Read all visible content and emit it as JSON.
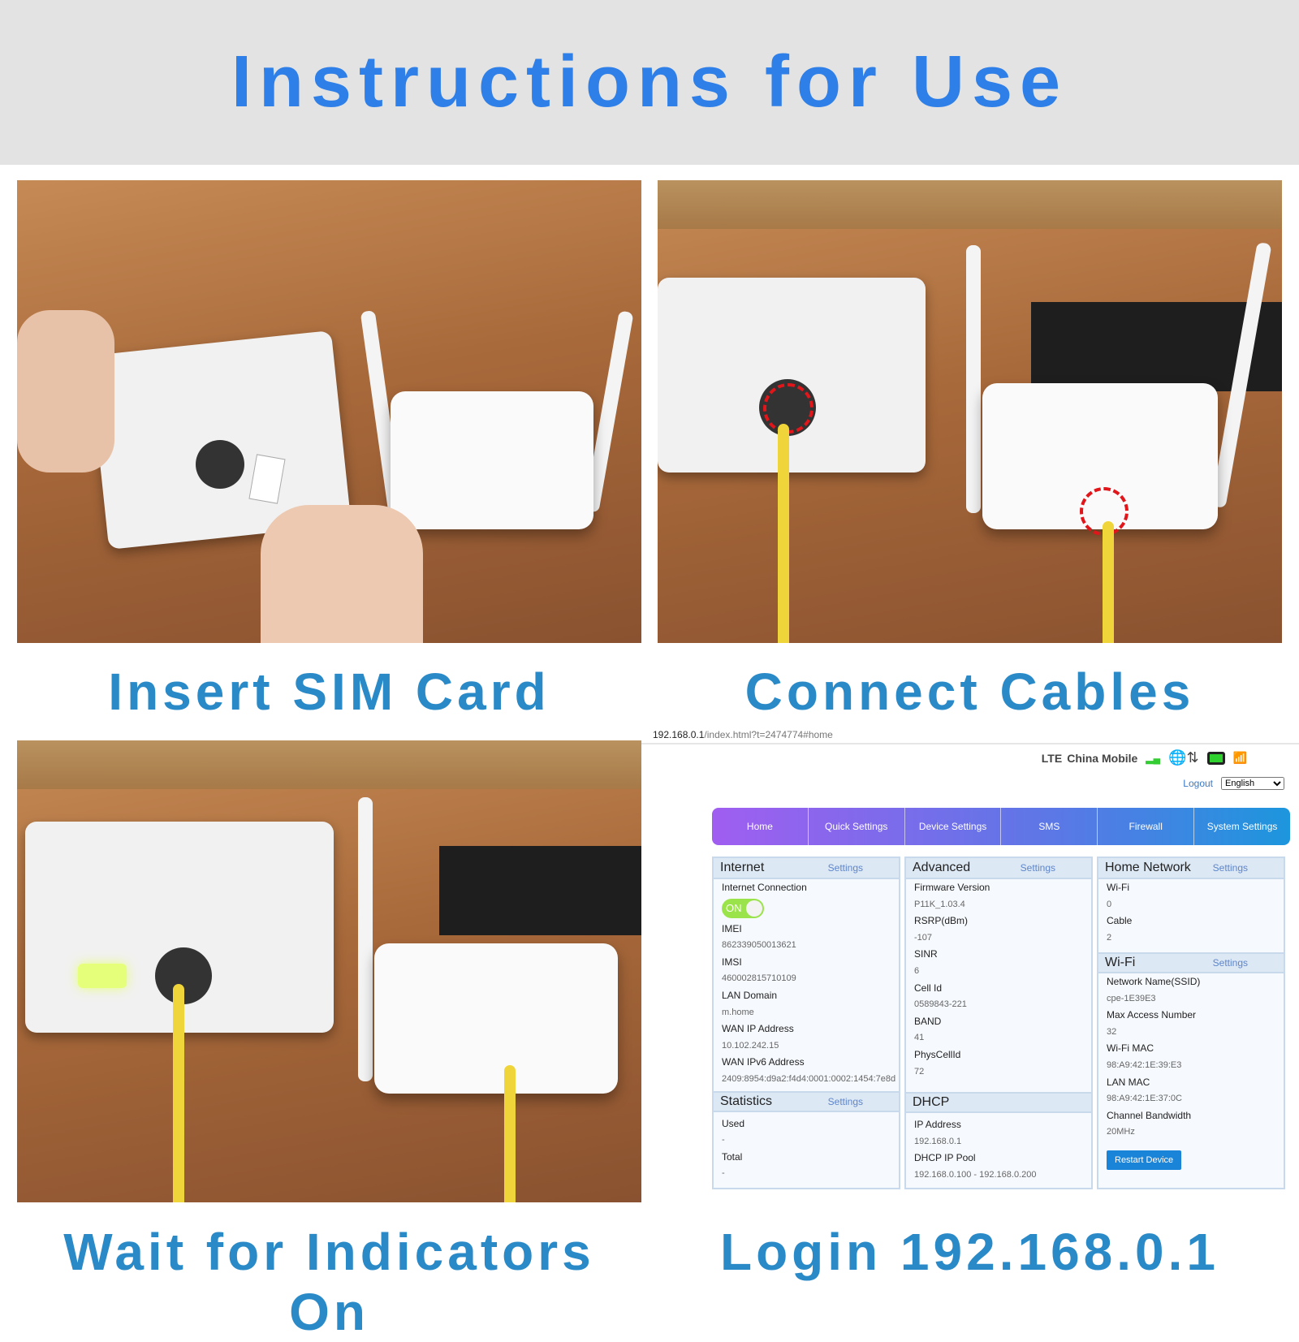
{
  "title": "Instructions for Use",
  "steps": [
    {
      "caption": "Insert SIM Card"
    },
    {
      "caption": "Connect Cables"
    },
    {
      "caption": "Wait for Indicators On"
    },
    {
      "caption": "Login 192.168.0.1"
    }
  ],
  "browser": {
    "url_host": "192.168.0.1",
    "url_path": "/index.html?t=2474774#home"
  },
  "status": {
    "network": "LTE",
    "carrier": "China Mobile"
  },
  "header": {
    "logout": "Logout",
    "language": "English"
  },
  "nav": [
    "Home",
    "Quick Settings",
    "Device Settings",
    "SMS",
    "Firewall",
    "System Settings"
  ],
  "internet": {
    "title": "Internet",
    "settings": "Settings",
    "connection_label": "Internet Connection",
    "toggle": "ON",
    "rows": [
      [
        "IMEI",
        "862339050013621"
      ],
      [
        "IMSI",
        "460002815710109"
      ],
      [
        "LAN Domain",
        "m.home"
      ],
      [
        "WAN IP Address",
        "10.102.242.15"
      ],
      [
        "WAN IPv6 Address",
        "2409:8954:d9a2:f4d4:0001:0002:1454:7e8d"
      ]
    ]
  },
  "statistics": {
    "title": "Statistics",
    "settings": "Settings",
    "rows": [
      [
        "Used",
        "-"
      ],
      [
        "Total",
        "-"
      ]
    ]
  },
  "advanced": {
    "title": "Advanced",
    "settings": "Settings",
    "rows": [
      [
        "Firmware Version",
        "P11K_1.03.4"
      ],
      [
        "RSRP(dBm)",
        "-107"
      ],
      [
        "SINR",
        "6"
      ],
      [
        "Cell Id",
        "0589843-221"
      ],
      [
        "BAND",
        "41"
      ],
      [
        "PhysCellId",
        "72"
      ]
    ]
  },
  "dhcp": {
    "title": "DHCP",
    "rows": [
      [
        "IP Address",
        "192.168.0.1"
      ],
      [
        "DHCP IP Pool",
        "192.168.0.100      -  192.168.0.200"
      ]
    ]
  },
  "home_network": {
    "title": "Home Network",
    "settings": "Settings",
    "rows": [
      [
        "Wi-Fi",
        "0"
      ],
      [
        "Cable",
        "2"
      ]
    ]
  },
  "wifi": {
    "title": "Wi-Fi",
    "settings": "Settings",
    "rows": [
      [
        "Network Name(SSID)",
        "cpe-1E39E3"
      ],
      [
        "Max Access Number",
        "32"
      ],
      [
        "Wi-Fi MAC",
        "98:A9:42:1E:39:E3"
      ],
      [
        "LAN MAC",
        "98:A9:42:1E:37:0C"
      ],
      [
        "Channel Bandwidth",
        "20MHz"
      ]
    ],
    "restart": "Restart Device"
  },
  "colors": {
    "title": "#2f7fe8",
    "caption": "#2a8ac8",
    "nav_start": "#a05ef0",
    "nav_end": "#1d96dd",
    "toggle_on": "#9be34b",
    "button": "#1a84d8"
  }
}
